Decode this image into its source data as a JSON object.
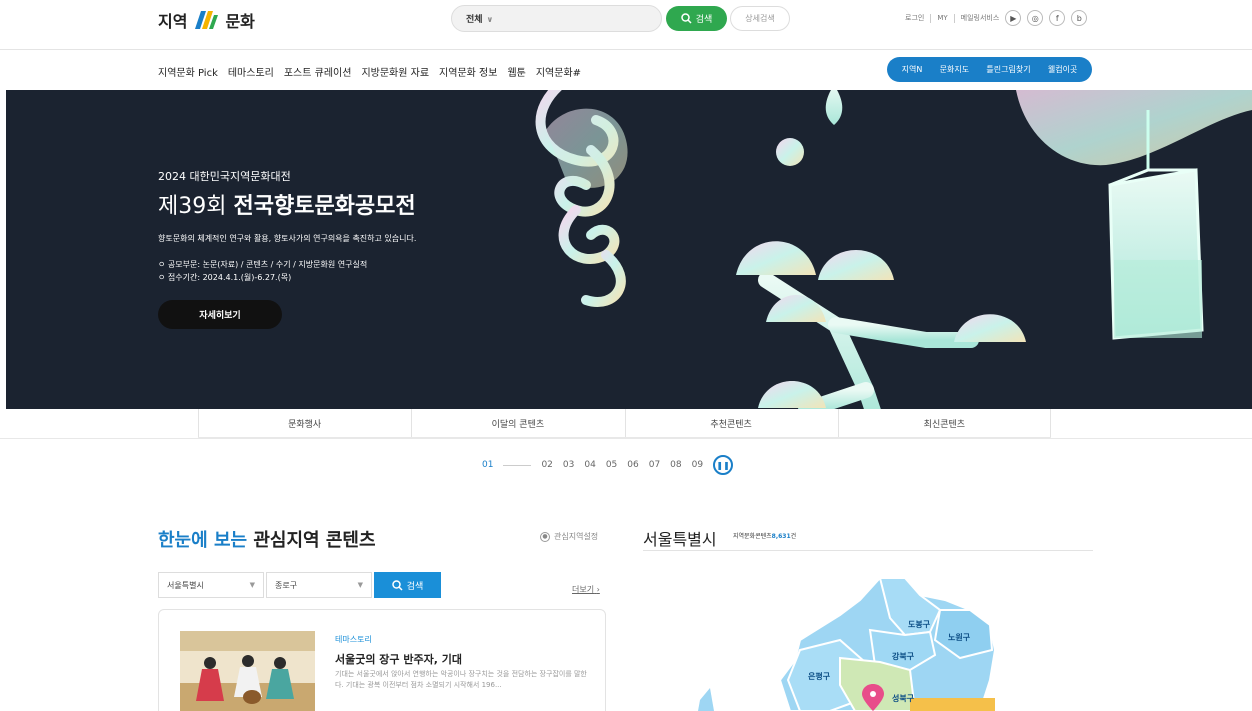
{
  "header": {
    "logo_left": "지역",
    "logo_right": "문화",
    "search_select": "전체",
    "search_placeholder": "",
    "search_button": "검색",
    "advanced_search": "상세검색",
    "util": {
      "login": "로그인",
      "my": "MY",
      "mail": "메일링서비스"
    },
    "sns": [
      "youtube",
      "instagram",
      "facebook",
      "blog"
    ]
  },
  "gnb": {
    "menu": [
      "지역문화 Pick",
      "테마스토리",
      "포스트 큐레이션",
      "지방문화원 자료",
      "지역문화 정보",
      "웹툰",
      "지역문화#"
    ],
    "quick": [
      "지역N",
      "문화지도",
      "틀린그림찾기",
      "웰컴이곳"
    ]
  },
  "banner": {
    "year": "2024 대한민국지역문화대전",
    "title_light": "제39회",
    "title_bold": "전국향토문화공모전",
    "desc": "향토문화의 체계적인 연구와 활용, 향토사가의 연구의욕을 촉진하고 있습니다.",
    "item1": "ㅇ 공모부문: 논문(자료) / 콘텐츠 / 수기 / 지방문화원 연구실적",
    "item2": "ㅇ 접수기간: 2024.4.1.(월)-6.27.(목)",
    "button": "자세히보기"
  },
  "tabs": [
    "문화행사",
    "이달의 콘텐츠",
    "추천콘텐츠",
    "최신콘텐츠"
  ],
  "pager": {
    "pages": [
      "01",
      "02",
      "03",
      "04",
      "05",
      "06",
      "07",
      "08",
      "09"
    ],
    "active": "01"
  },
  "interest": {
    "title_hl": "한눈에 보는",
    "title_rest": "관심지역 콘텐츠",
    "setting": "관심지역설정",
    "city": "서울특별시",
    "district": "종로구",
    "search": "검색",
    "more": "더보기",
    "card": {
      "tag": "테마스토리",
      "title": "서울굿의 장구 반주자, 기대",
      "desc": "기대는 서울굿에서 앉아서 연행하는 악공이나 장구치는 것을 전담하는 장구잡이를 말한다. 기대는 광복 이전부터 점차 소멸되기 시작해서 196..."
    }
  },
  "seoul": {
    "title": "서울특별시",
    "count_label": "지역문화콘텐츠",
    "count": "8,631",
    "count_unit": "건",
    "districts": [
      "도봉구",
      "노원구",
      "강북구",
      "은평구",
      "성북구"
    ]
  },
  "colors": {
    "brand_blue": "#1a7fc8",
    "brand_green": "#2fa84f",
    "banner_bg": "#1b2330"
  }
}
